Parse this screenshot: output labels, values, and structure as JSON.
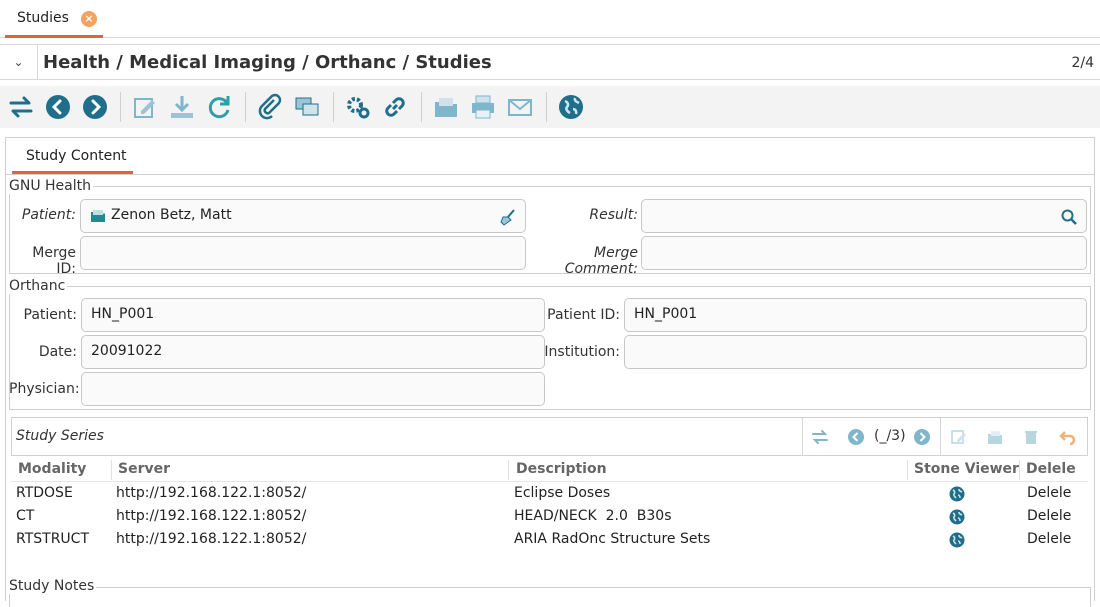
{
  "tabs": [
    {
      "label": "Studies"
    }
  ],
  "header": {
    "breadcrumb": "Health / Medical Imaging / Orthanc / Studies",
    "pager": "2/4"
  },
  "toolbar": {
    "icons": [
      "switch-view-icon",
      "previous-icon",
      "next-icon",
      "edit-icon",
      "save-icon",
      "reload-icon",
      "attachment-icon",
      "notes-icon",
      "action-icon",
      "relate-icon",
      "open-folder-icon",
      "print-icon",
      "email-icon",
      "globe-icon"
    ]
  },
  "content_tab": {
    "label": "Study Content"
  },
  "gnu_health": {
    "legend": "GNU Health",
    "patient_label": "Patient:",
    "patient_value": "Zenon Betz, Matt",
    "result_label": "Result:",
    "result_value": "",
    "merge_id_label": "Merge ID:",
    "merge_id_value": "",
    "merge_comment_label": "Merge Comment:",
    "merge_comment_value": ""
  },
  "orthanc": {
    "legend": "Orthanc",
    "patient_label": "Patient:",
    "patient_value": "HN_P001",
    "patient_id_label": "Patient ID:",
    "patient_id_value": "HN_P001",
    "date_label": "Date:",
    "date_value": "20091022",
    "institution_label": "Institution:",
    "institution_value": "",
    "physician_label": "Physician:",
    "physician_value": ""
  },
  "series": {
    "title": "Study Series",
    "record_counter": "(_/3)",
    "columns": [
      "Modality",
      "Server",
      "Description",
      "Stone Viewer",
      "Delele"
    ],
    "rows": [
      {
        "modality": "RTDOSE",
        "server": "http://192.168.122.1:8052/",
        "description": "Eclipse Doses",
        "action": "Delele"
      },
      {
        "modality": "CT",
        "server": "http://192.168.122.1:8052/",
        "description": "HEAD/NECK  2.0  B30s",
        "action": "Delele"
      },
      {
        "modality": "RTSTRUCT",
        "server": "http://192.168.122.1:8052/",
        "description": "ARIA RadOnc Structure Sets",
        "action": "Delele"
      }
    ]
  },
  "notes": {
    "legend": "Study Notes"
  },
  "colors": {
    "accent": "#e0643b",
    "icon_teal": "#1f6f8b",
    "icon_light": "#7fb6cc"
  }
}
